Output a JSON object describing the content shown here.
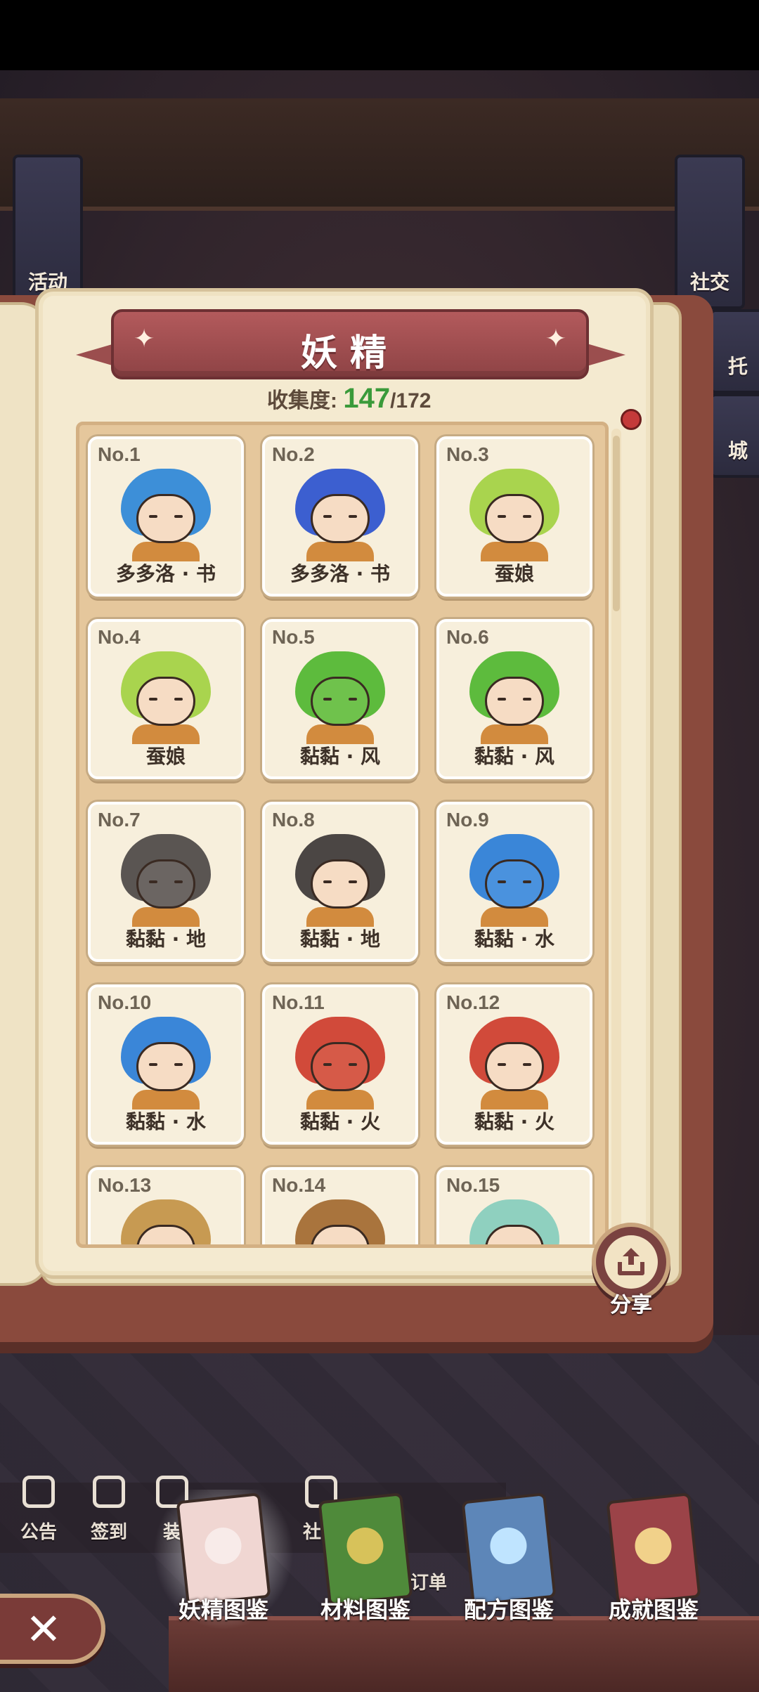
{
  "background": {
    "left_banner_label": "活动",
    "right_banner_labels": [
      "社交",
      "托",
      "城"
    ],
    "toolbar": [
      "公告",
      "签到",
      "装",
      "社区"
    ],
    "order_label": "订单"
  },
  "book": {
    "title": "妖精",
    "collection": {
      "label": "收集度:",
      "count": "147",
      "total": "/172"
    },
    "cards": [
      {
        "no": "No.1",
        "name": "多多洛 · 书",
        "hair": "#3d8fd8",
        "face": "#f6dcc4"
      },
      {
        "no": "No.2",
        "name": "多多洛 · 书",
        "hair": "#3c5fd0",
        "face": "#f6dcc4"
      },
      {
        "no": "No.3",
        "name": "蚕娘",
        "hair": "#a9d44e",
        "face": "#f6dcc4"
      },
      {
        "no": "No.4",
        "name": "蚕娘",
        "hair": "#a9d44e",
        "face": "#f6dcc4"
      },
      {
        "no": "No.5",
        "name": "黏黏 · 风",
        "hair": "#5dbb3d",
        "face": "#6fc24c"
      },
      {
        "no": "No.6",
        "name": "黏黏 · 风",
        "hair": "#5dbb3d",
        "face": "#f6dcc4"
      },
      {
        "no": "No.7",
        "name": "黏黏 · 地",
        "hair": "#5a5552",
        "face": "#6b6562"
      },
      {
        "no": "No.8",
        "name": "黏黏 · 地",
        "hair": "#4b4644",
        "face": "#f6dcc4"
      },
      {
        "no": "No.9",
        "name": "黏黏 · 水",
        "hair": "#3a86d8",
        "face": "#4a92de"
      },
      {
        "no": "No.10",
        "name": "黏黏 · 水",
        "hair": "#3a86d8",
        "face": "#f6dcc4"
      },
      {
        "no": "No.11",
        "name": "黏黏 · 火",
        "hair": "#d14a3a",
        "face": "#d65a48"
      },
      {
        "no": "No.12",
        "name": "黏黏 · 火",
        "hair": "#d14a3a",
        "face": "#f6dcc4"
      },
      {
        "no": "No.13",
        "name": "",
        "hair": "#c79a52",
        "face": "#f6dcc4"
      },
      {
        "no": "No.14",
        "name": "",
        "hair": "#a9743d",
        "face": "#f6dcc4"
      },
      {
        "no": "No.15",
        "name": "",
        "hair": "#8fd0bf",
        "face": "#f6dcc4"
      }
    ],
    "share_label": "分享"
  },
  "tabs": [
    {
      "label": "妖精图鉴",
      "color": "#f0d6d2",
      "active": true
    },
    {
      "label": "材料图鉴",
      "color": "#4f8a3a",
      "active": false
    },
    {
      "label": "配方图鉴",
      "color": "#5d86b8",
      "active": false
    },
    {
      "label": "成就图鉴",
      "color": "#9b4348",
      "active": false
    }
  ],
  "icons": {
    "close": "close-icon",
    "share": "share-icon"
  }
}
